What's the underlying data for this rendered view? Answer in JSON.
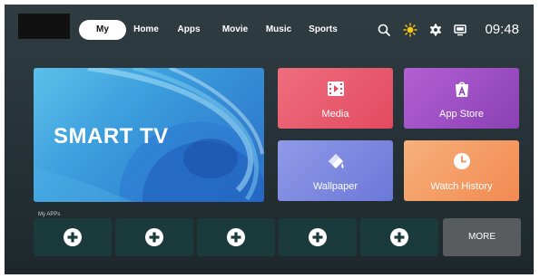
{
  "nav": {
    "tabs": [
      {
        "label": "My",
        "active": true
      },
      {
        "label": "Home",
        "active": false
      },
      {
        "label": "Apps",
        "active": false
      },
      {
        "label": "Movie",
        "active": false
      },
      {
        "label": "Music",
        "active": false
      },
      {
        "label": "Sports",
        "active": false
      }
    ],
    "icons": [
      "search-icon",
      "brightness-icon",
      "settings-icon",
      "input-source-icon"
    ],
    "clock": "09:48"
  },
  "hero": {
    "title": "SMART TV"
  },
  "tiles": [
    {
      "label": "Media",
      "icon": "media-icon",
      "color": "#e9556b"
    },
    {
      "label": "App Store",
      "icon": "app-store-icon",
      "color": "#9d4fc0"
    },
    {
      "label": "Wallpaper",
      "icon": "wallpaper-icon",
      "color": "#7f8be3"
    },
    {
      "label": "Watch History",
      "icon": "history-icon",
      "color": "#f39d63"
    }
  ],
  "my_apps": {
    "label": "My APPs",
    "slots": 5,
    "more_label": "MORE"
  },
  "colors": {
    "accent_sun": "#f5c518",
    "slot_bg": "#1a3a3c",
    "more_bg": "#585c5e"
  }
}
